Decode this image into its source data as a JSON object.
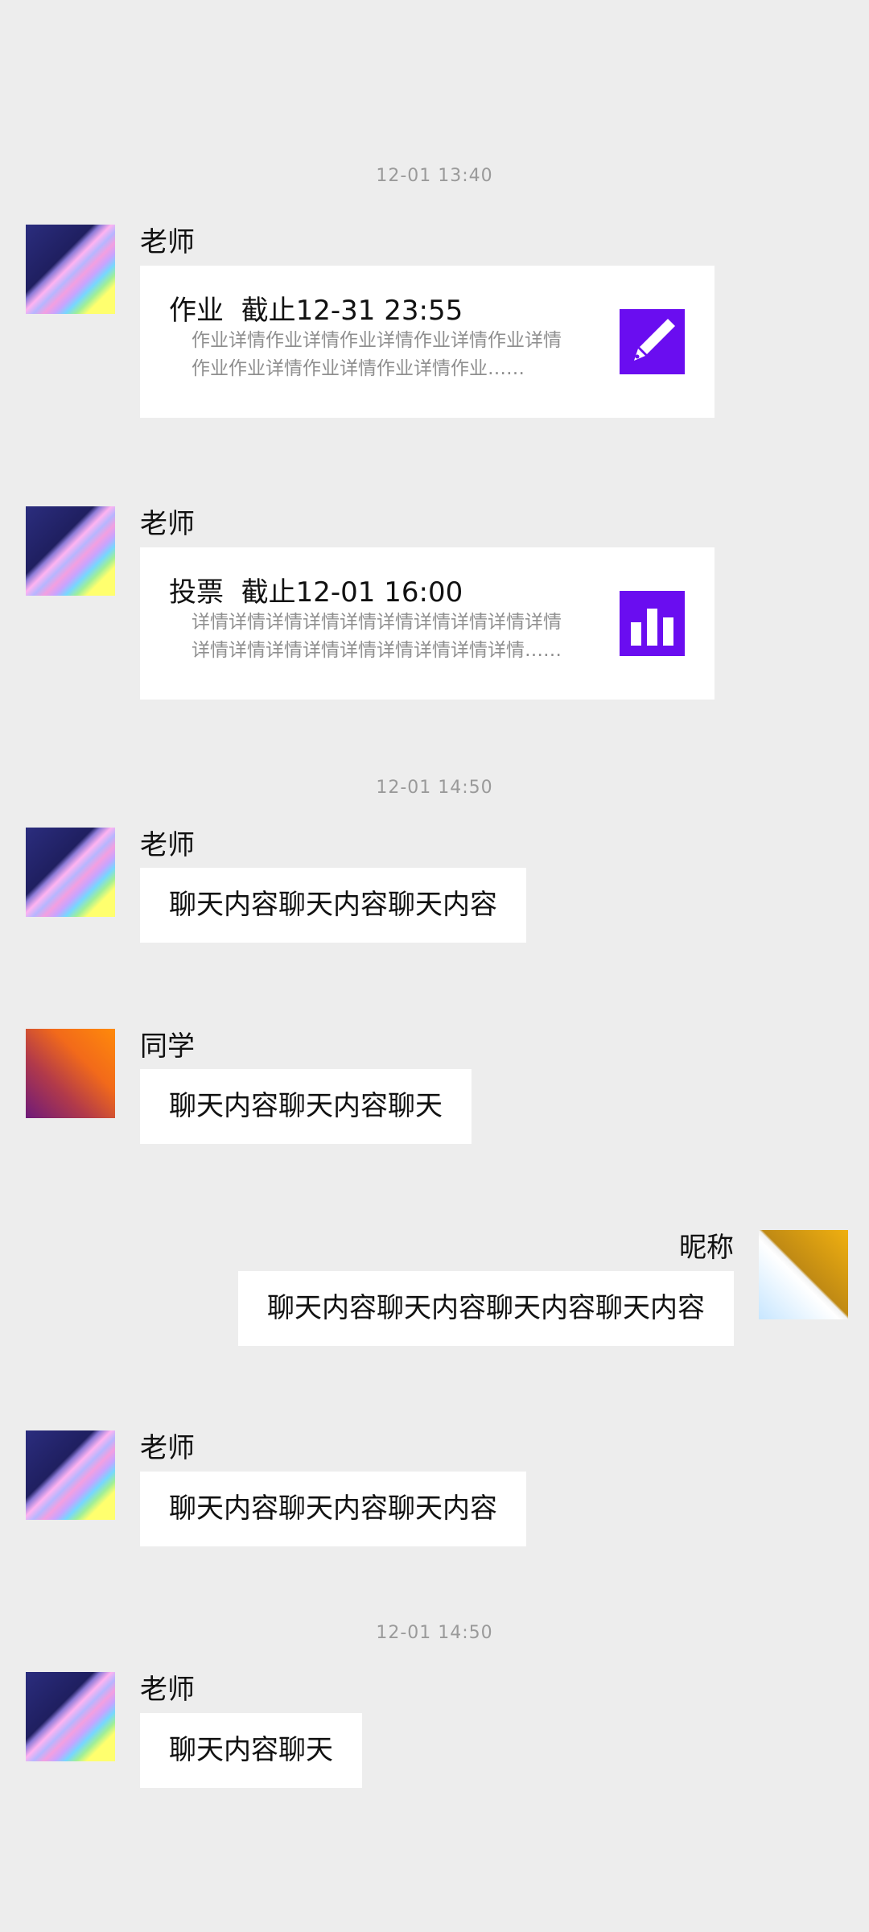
{
  "timestamps": [
    "12-01 13:40",
    "12-01 14:50",
    "12-01 14:50"
  ],
  "messages": [
    {
      "sender": "老师",
      "card": {
        "kind": "作业",
        "deadline": "截止12-31 23:55",
        "desc": [
          "作业详情作业详情作业详情作业详情作业详情",
          "作业作业详情作业详情作业详情作业……"
        ],
        "icon": "pen-icon"
      }
    },
    {
      "sender": "老师",
      "card": {
        "kind": "投票",
        "deadline": "截止12-01 16:00",
        "desc": [
          "详情详情详情详情详情详情详情详情详情详情",
          "详情详情详情详情详情详情详情详情详情……"
        ],
        "icon": "bar-chart-icon"
      }
    },
    {
      "sender": "老师",
      "text": "聊天内容聊天内容聊天内容"
    },
    {
      "sender": "同学",
      "text": "聊天内容聊天内容聊天"
    },
    {
      "sender": "昵称",
      "text": "聊天内容聊天内容聊天内容聊天内容"
    },
    {
      "sender": "老师",
      "text": "聊天内容聊天内容聊天内容"
    },
    {
      "sender": "老师",
      "text": "聊天内容聊天"
    }
  ],
  "colors": {
    "background": "#ededed",
    "accent": "#6a0df0",
    "bubble": "#ffffff",
    "timestamp": "#9a9a9a"
  }
}
